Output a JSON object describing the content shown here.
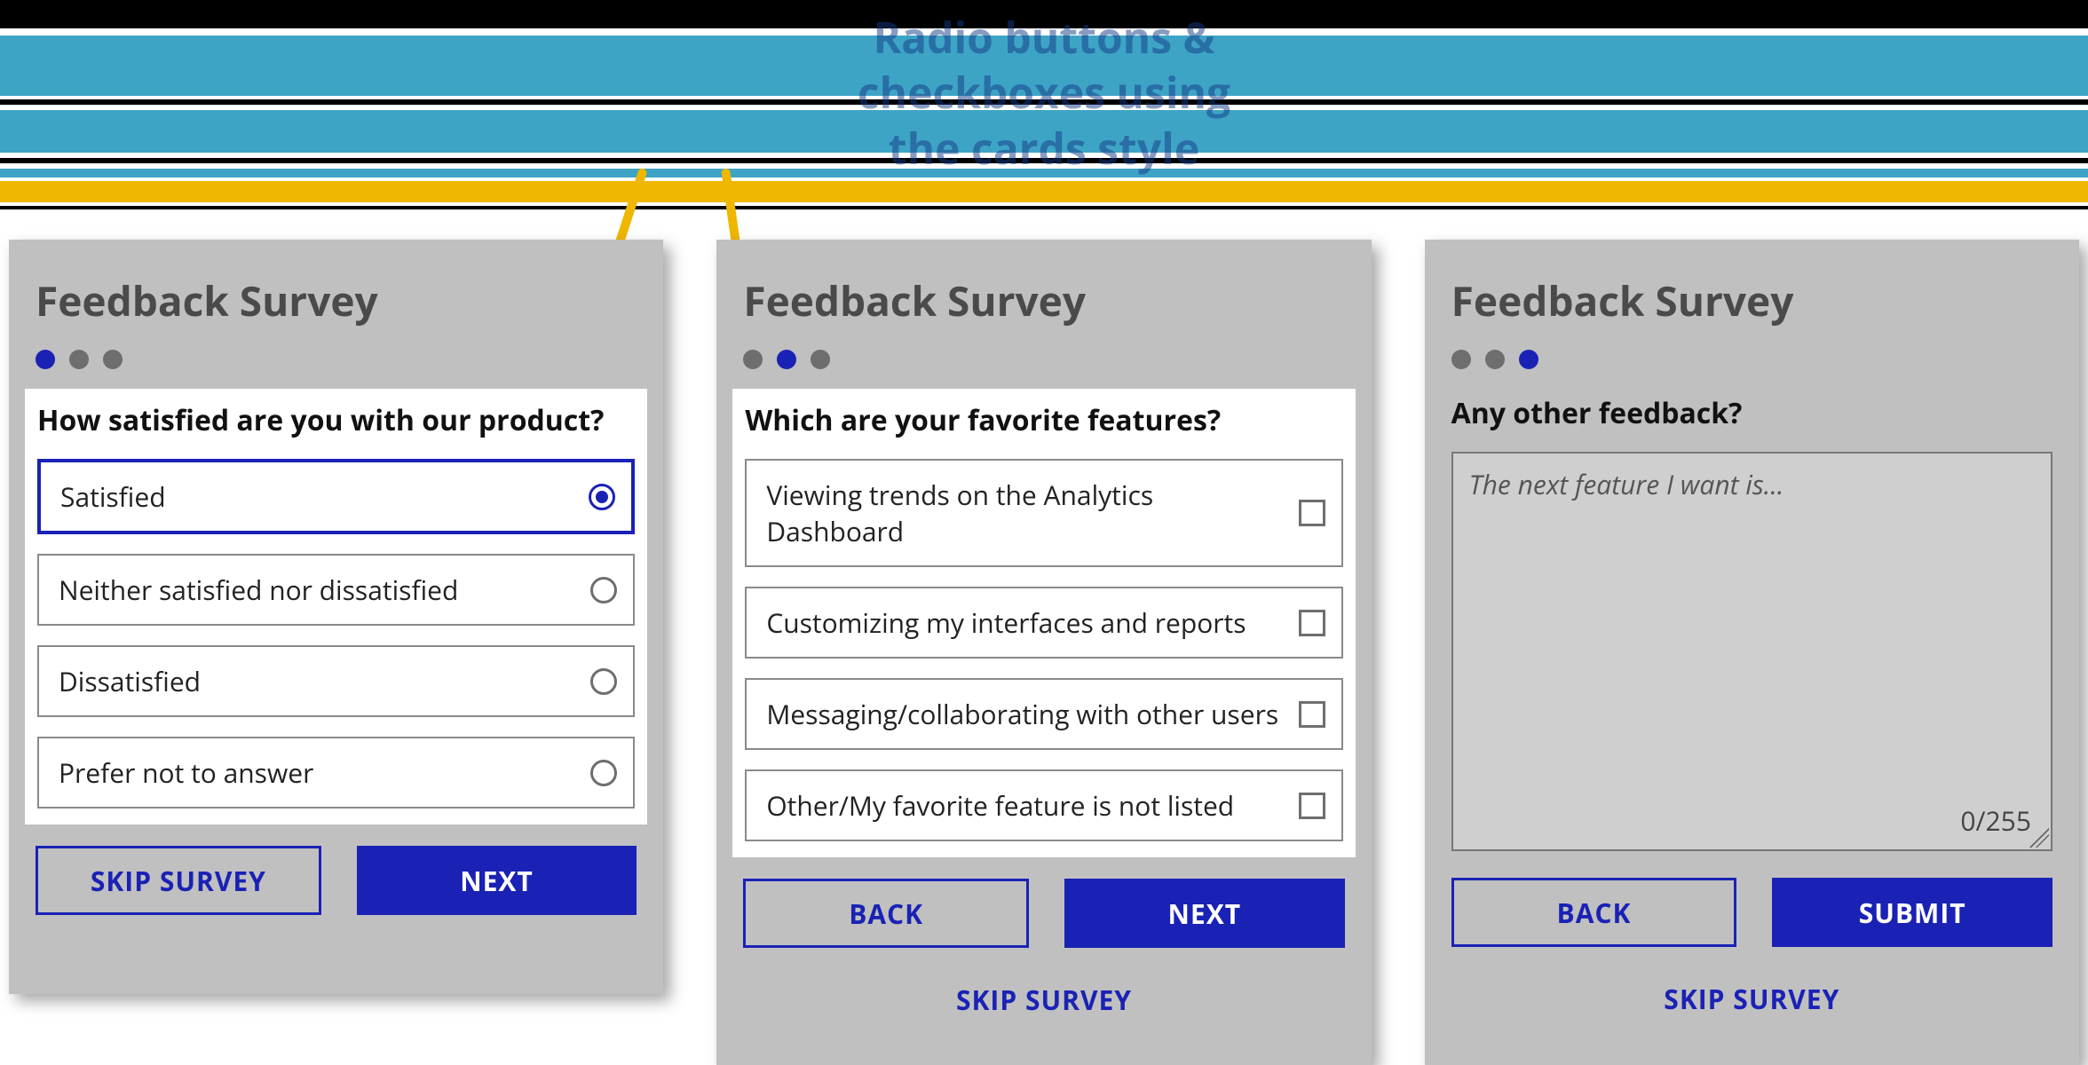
{
  "annotation": {
    "line1": "Radio buttons &",
    "line2": "checkboxes using",
    "line3": "the cards style"
  },
  "surveys": {
    "title": "Feedback Survey",
    "buttons": {
      "skip": "SKIP SURVEY",
      "next": "NEXT",
      "back": "BACK",
      "submit": "SUBMIT"
    },
    "step1": {
      "active_dot": 0,
      "question": "How satisfied are you with our product?",
      "options": [
        {
          "label": "Satisfied",
          "selected": true
        },
        {
          "label": "Neither satisfied nor dissatisfied",
          "selected": false
        },
        {
          "label": "Dissatisfied",
          "selected": false
        },
        {
          "label": "Prefer not to answer",
          "selected": false
        }
      ]
    },
    "step2": {
      "active_dot": 1,
      "question": "Which are your favorite features?",
      "options": [
        {
          "label": "Viewing trends on the Analytics Dashboard",
          "checked": false
        },
        {
          "label": "Customizing my interfaces and reports",
          "checked": false
        },
        {
          "label": "Messaging/collaborating with other users",
          "checked": false
        },
        {
          "label": "Other/My favorite feature is not listed",
          "checked": false
        }
      ]
    },
    "step3": {
      "active_dot": 2,
      "question": "Any other feedback?",
      "placeholder": "The next feature I want is...",
      "char_count": "0/255"
    }
  }
}
